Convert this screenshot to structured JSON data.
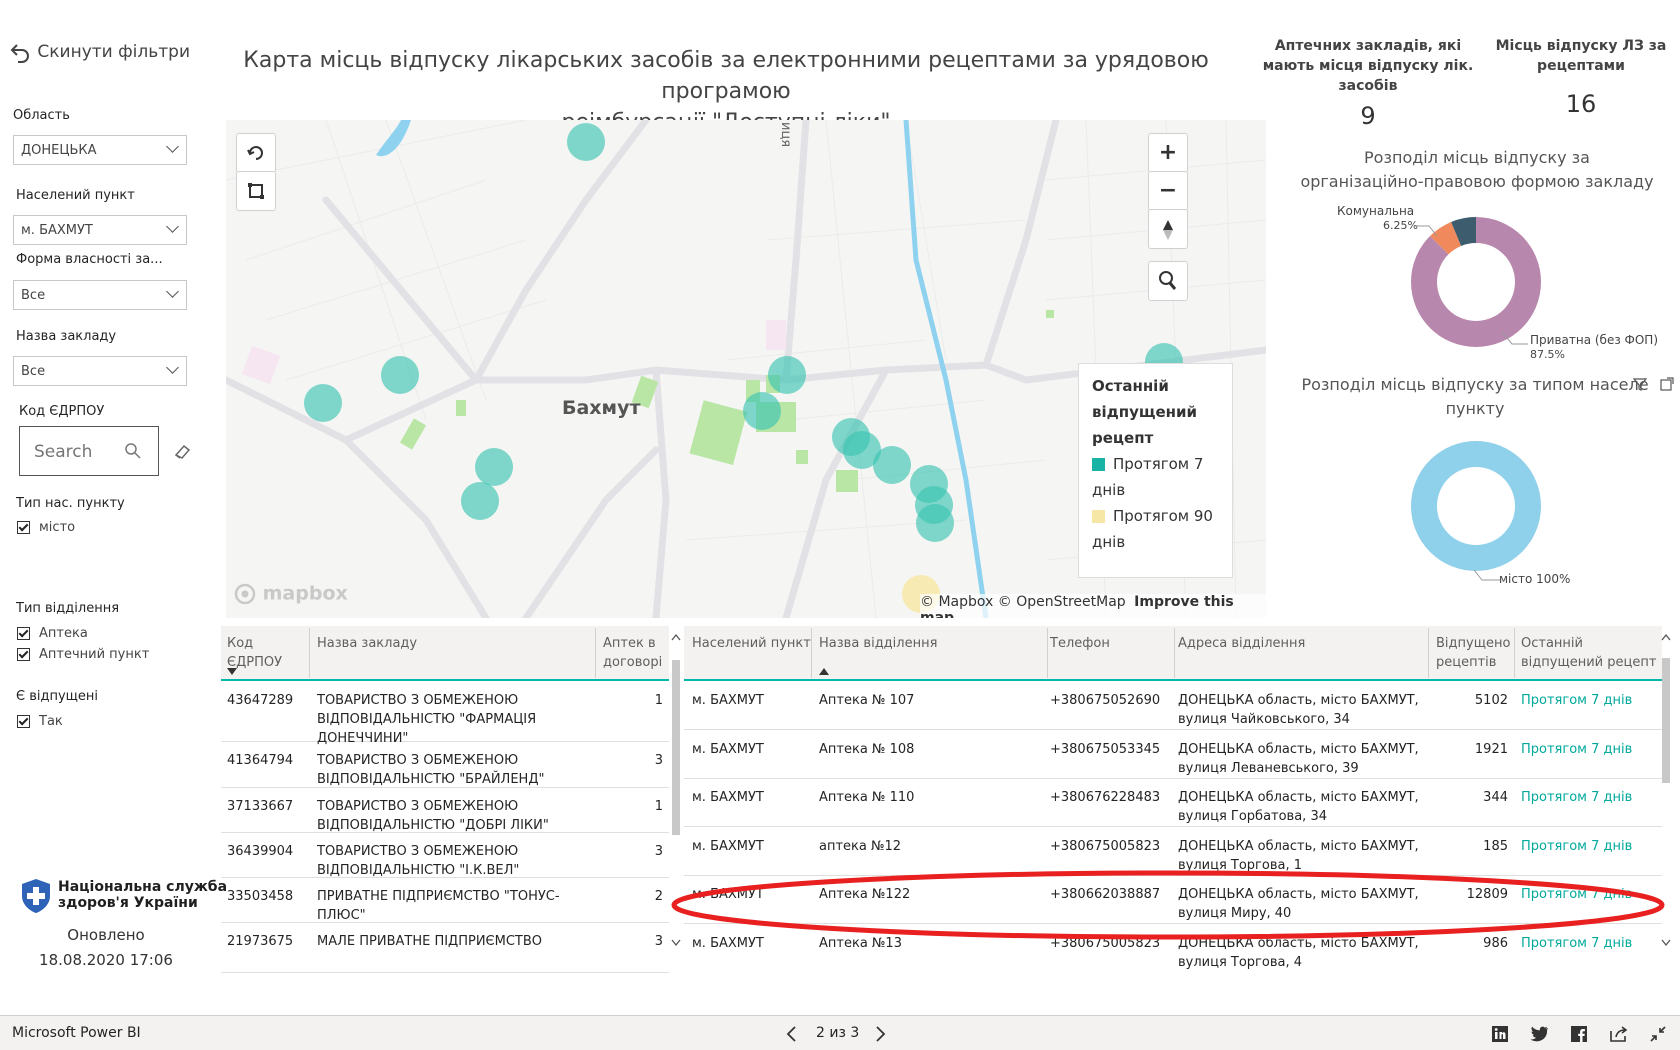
{
  "reset_filters": "Скинути фільтри",
  "title_line1": "Карта місць відпуску лікарських засобів за електронними рецептами за урядовою програмою",
  "title_line2": "реімбурсації \"Доступні ліки\"",
  "filters": {
    "region_label": "Область",
    "region_value": "ДОНЕЦЬКА",
    "city_label": "Населений пункт",
    "city_value": "м. БАХМУТ",
    "ownership_label": "Форма власності за...",
    "ownership_value": "Все",
    "facility_label": "Назва закладу",
    "facility_value": "Все",
    "edrpou_label": "Код ЄДРПОУ",
    "search_placeholder": "Search",
    "settlement_type_label": "Тип нас. пункту",
    "settlement_type_item": "місто",
    "branch_type_label": "Тип відділення",
    "branch_type_items": [
      "Аптека",
      "Аптечний пункт"
    ],
    "dispensed_label": "Є відпущені",
    "dispensed_item": "Так"
  },
  "brand": {
    "name_line1": "Національна служба",
    "name_line2": "здоров'я України",
    "updated_label": "Оновлено",
    "updated_value": "18.08.2020 17:06"
  },
  "kpis": {
    "pharmacies_label_1": "Аптечних закладів, які",
    "pharmacies_label_2": "мають місця відпуску лік.",
    "pharmacies_label_3": "засобів",
    "pharmacies_value": "9",
    "points_label_1": "Місць відпуску ЛЗ за",
    "points_label_2": "рецептами",
    "points_value": "16"
  },
  "donut1": {
    "title_line1": "Розподіл місць відпуску за",
    "title_line2": "організаційно-правовою формою закладу",
    "label_communal": "Комунальна",
    "label_communal_pct": "6.25%",
    "label_private": "Приватна (без ФОП)",
    "label_private_pct": "87.5%",
    "slices": [
      {
        "name": "Приватна (без ФОП)",
        "value": 87.5,
        "color": "#b887ad"
      },
      {
        "name": "Комунальна",
        "value": 6.25,
        "color": "#3d5d6e"
      },
      {
        "name": "",
        "value": 6.25,
        "color": "#f08a5d"
      }
    ]
  },
  "donut2": {
    "title_line1": "Розподіл місць відпуску за типом населе",
    "title_line2": "пункту",
    "label": "місто 100%",
    "color": "#8fd0ea"
  },
  "map": {
    "city_label": "Бахмут",
    "street_label": "иця",
    "mapbox_logo": "mapbox",
    "attribution": "© Mapbox © OpenStreetMap",
    "improve": "Improve this map",
    "legend_title_1": "Останній",
    "legend_title_2": "відпущений",
    "legend_title_3": "рецепт",
    "legend_item1_a": "Протягом 7",
    "legend_item1_b": "днів",
    "legend_item2_a": "Протягом 90",
    "legend_item2_b": "днів",
    "color_7": "#3cc5b2",
    "color_90": "#f7e7a7",
    "zoom_in": "+",
    "zoom_out": "−"
  },
  "left_table": {
    "headers": [
      "Код ЄДРПОУ",
      "Назва закладу",
      "Аптек в договорі"
    ],
    "header_code_1": "Код",
    "header_code_2": "ЄДРПОУ",
    "header_name": "Назва закладу",
    "header_count_1": "Аптек в",
    "header_count_2": "договорі",
    "rows": [
      {
        "code": "43647289",
        "name1": "ТОВАРИСТВО З ОБМЕЖЕНОЮ",
        "name2": "ВІДПОВІДАЛЬНІСТЮ \"ФАРМАЦІЯ",
        "name3": "ДОНЕЧЧИНИ\"",
        "count": "1"
      },
      {
        "code": "41364794",
        "name1": "ТОВАРИСТВО З ОБМЕЖЕНОЮ",
        "name2": "ВІДПОВІДАЛЬНІСТЮ \"БРАЙЛЕНД\"",
        "name3": "",
        "count": "3"
      },
      {
        "code": "37133667",
        "name1": "ТОВАРИСТВО З ОБМЕЖЕНОЮ",
        "name2": "ВІДПОВІДАЛЬНІСТЮ \"ДОБРІ ЛІКИ\"",
        "name3": "",
        "count": "1"
      },
      {
        "code": "36439904",
        "name1": "ТОВАРИСТВО З ОБМЕЖЕНОЮ",
        "name2": "ВІДПОВІДАЛЬНІСТЮ \"І.К.ВЕЛ\"",
        "name3": "",
        "count": "3"
      },
      {
        "code": "33503458",
        "name1": "ПРИВАТНЕ ПІДПРИЄМСТВО \"ТОНУС-",
        "name2": "ПЛЮС\"",
        "name3": "",
        "count": "2"
      },
      {
        "code": "21973675",
        "name1": "МАЛЕ ПРИВАТНЕ ПІДПРИЄМСТВО",
        "name2": "",
        "name3": "",
        "count": "3"
      }
    ]
  },
  "right_table": {
    "header_city": "Населений пункт",
    "header_branch": "Назва відділення",
    "header_phone": "Телефон",
    "header_address": "Адреса відділення",
    "header_issued_1": "Відпущено",
    "header_issued_2": "рецептів",
    "header_last_1": "Останній",
    "header_last_2": "відпущений рецепт",
    "rows": [
      {
        "city": "м. БАХМУТ",
        "branch": "Аптека № 107",
        "phone": "+380675052690",
        "addr1": "ДОНЕЦЬКА область, місто БАХМУТ,",
        "addr2": "вулиця Чайковського, 34",
        "issued": "5102",
        "last": "Протягом 7 днів"
      },
      {
        "city": "м. БАХМУТ",
        "branch": "Аптека № 108",
        "phone": "+380675053345",
        "addr1": "ДОНЕЦЬКА область, місто БАХМУТ,",
        "addr2": "вулиця Леваневського, 39",
        "issued": "1921",
        "last": "Протягом 7 днів"
      },
      {
        "city": "м. БАХМУТ",
        "branch": "Аптека № 110",
        "phone": "+380676228483",
        "addr1": "ДОНЕЦЬКА область, місто БАХМУТ,",
        "addr2": "вулиця Горбатова, 34",
        "issued": "344",
        "last": "Протягом 7 днів"
      },
      {
        "city": "м. БАХМУТ",
        "branch": "аптека №12",
        "phone": "+380675005823",
        "addr1": "ДОНЕЦЬКА область, місто БАХМУТ,",
        "addr2": "вулиця Торгова, 1",
        "issued": "185",
        "last": "Протягом 7 днів"
      },
      {
        "city": "м. БАХМУТ",
        "branch": "Аптека №122",
        "phone": "+380662038887",
        "addr1": "ДОНЕЦЬКА область, місто БАХМУТ,",
        "addr2": "вулиця Миру, 40",
        "issued": "12809",
        "last": "Протягом 7 днів"
      },
      {
        "city": "м. БАХМУТ",
        "branch": "Аптека №13",
        "phone": "+380675005823",
        "addr1": "ДОНЕЦЬКА область, місто БАХМУТ,",
        "addr2": "вулиця Торгова, 4",
        "issued": "986",
        "last": "Протягом 7 днів"
      }
    ]
  },
  "footer": {
    "app_name": "Microsoft Power BI",
    "pager": "2 из 3"
  }
}
